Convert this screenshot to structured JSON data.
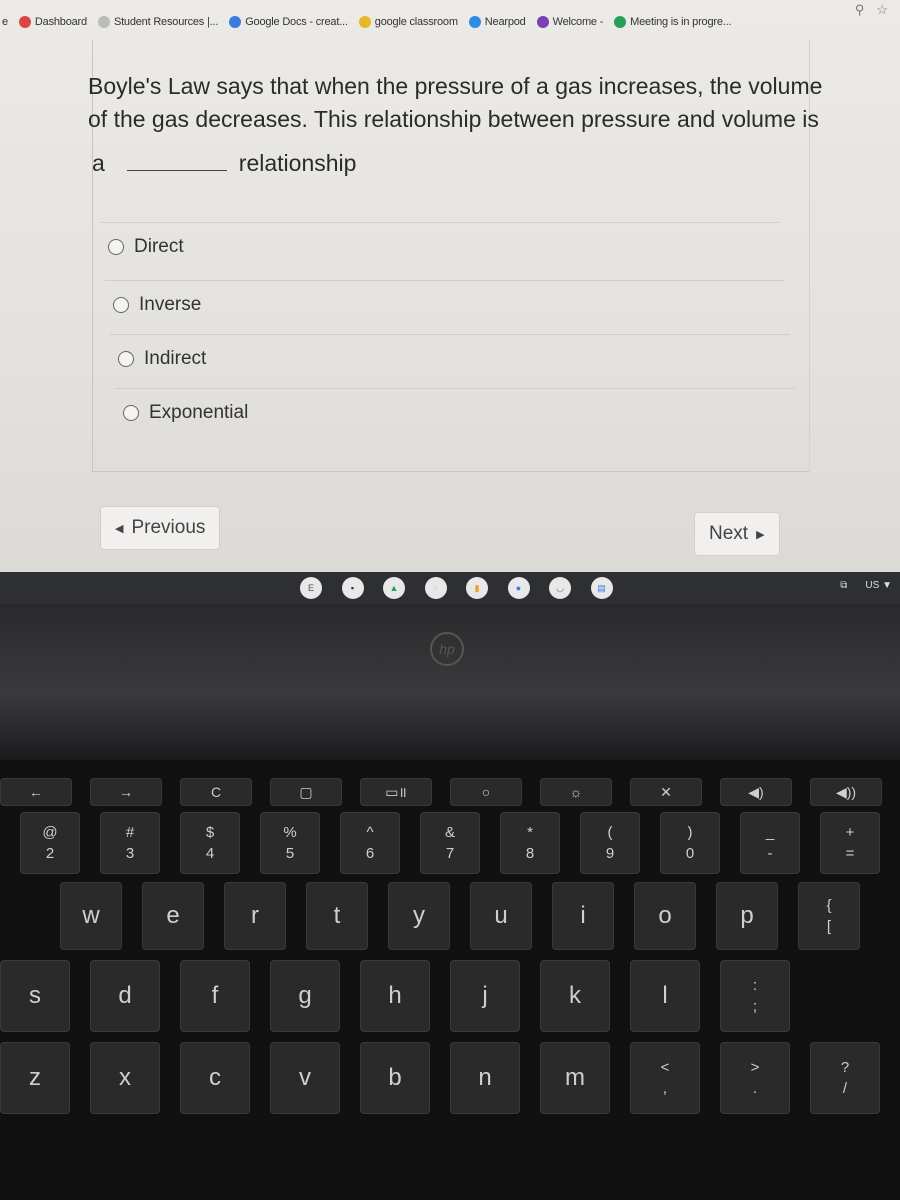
{
  "bookmarks": [
    {
      "label": "e",
      "icon": "tab-fragment",
      "color": "#e4e2de"
    },
    {
      "label": "Dashboard",
      "icon": "canvas-icon",
      "color": "#d44"
    },
    {
      "label": "Student Resources |...",
      "icon": "globe-icon",
      "color": "#bbb"
    },
    {
      "label": "Google Docs - creat...",
      "icon": "docs-icon",
      "color": "#3b7be0"
    },
    {
      "label": "google classroom",
      "icon": "classroom-icon",
      "color": "#e7b72a"
    },
    {
      "label": "Nearpod",
      "icon": "nearpod-icon",
      "color": "#2b8be6"
    },
    {
      "label": "Welcome -",
      "icon": "welcome-icon",
      "color": "#7a3fb0"
    },
    {
      "label": "Meeting is in progre...",
      "icon": "meet-icon",
      "color": "#2a9d5a"
    }
  ],
  "quiz": {
    "question": "Boyle's Law says that when the pressure of a gas increases, the volume of the gas decreases. This relationship between pressure and volume is",
    "prefix": "a",
    "suffix": "relationship",
    "options": [
      "Direct",
      "Inverse",
      "Indirect",
      "Exponential"
    ],
    "previous": "Previous",
    "next": "Next"
  },
  "shelf": {
    "apps": [
      {
        "icon": "e-app-icon",
        "label": "E",
        "color": "#555"
      },
      {
        "icon": "save-app-icon",
        "label": "▪",
        "color": "#333"
      },
      {
        "icon": "drive-icon",
        "label": "▲",
        "color": "#2a9d5a"
      },
      {
        "icon": "light-bulb-icon",
        "label": "○",
        "color": "#9cc"
      },
      {
        "icon": "keep-icon",
        "label": "▮",
        "color": "#f0a020"
      },
      {
        "icon": "chrome-icon",
        "label": "●",
        "color": "#3b7be0"
      },
      {
        "icon": "classroom-app-icon",
        "label": "◡",
        "color": "#2a8a4a"
      },
      {
        "icon": "docs-app-icon",
        "label": "▤",
        "color": "#3b7be0"
      }
    ],
    "tray_locale": "US"
  },
  "brand": "hp",
  "keyboard": {
    "rows": [
      [
        {
          "m": "←"
        },
        {
          "m": "→"
        },
        {
          "m": "C"
        },
        {
          "m": "▢"
        },
        {
          "m": "▭॥"
        },
        {
          "m": "○"
        },
        {
          "m": "☼"
        },
        {
          "m": "✕"
        },
        {
          "m": "◀)"
        },
        {
          "m": "◀))"
        }
      ],
      [
        {
          "t": "@",
          "b": "2"
        },
        {
          "t": "#",
          "b": "3"
        },
        {
          "t": "$",
          "b": "4"
        },
        {
          "t": "%",
          "b": "5"
        },
        {
          "t": "^",
          "b": "6"
        },
        {
          "t": "&",
          "b": "7"
        },
        {
          "t": "*",
          "b": "8"
        },
        {
          "t": "(",
          "b": "9"
        },
        {
          "t": ")",
          "b": "0"
        },
        {
          "t": "_",
          "b": "-"
        },
        {
          "t": "+",
          "b": "="
        }
      ],
      [
        {
          "m": "w"
        },
        {
          "m": "e"
        },
        {
          "m": "r"
        },
        {
          "m": "t"
        },
        {
          "m": "y"
        },
        {
          "m": "u"
        },
        {
          "m": "i"
        },
        {
          "m": "o"
        },
        {
          "m": "p"
        },
        {
          "t": "{",
          "b": "["
        }
      ],
      [
        {
          "m": "s"
        },
        {
          "m": "d"
        },
        {
          "m": "f"
        },
        {
          "m": "g"
        },
        {
          "m": "h"
        },
        {
          "m": "j"
        },
        {
          "m": "k"
        },
        {
          "m": "l"
        },
        {
          "t": ":",
          "b": ";"
        }
      ],
      [
        {
          "m": "z"
        },
        {
          "m": "x"
        },
        {
          "m": "c"
        },
        {
          "m": "v"
        },
        {
          "m": "b"
        },
        {
          "m": "n"
        },
        {
          "m": "m"
        },
        {
          "t": "<",
          "b": ","
        },
        {
          "t": ">",
          "b": "."
        },
        {
          "t": "?",
          "b": "/"
        }
      ]
    ]
  }
}
